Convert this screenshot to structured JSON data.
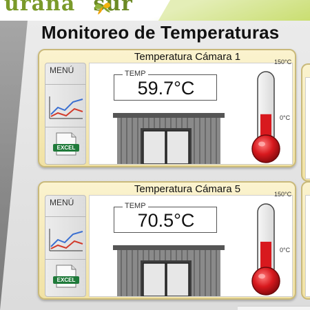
{
  "brand": {
    "part1": "urana",
    "part2": "sur"
  },
  "page": {
    "title": "Monitoreo de Temperaturas"
  },
  "panels": [
    {
      "title": "Temperatura Cámara 1",
      "menu_label": "MENÚ",
      "excel_label": "EXCEL",
      "temp_label": "TEMP",
      "temp_value": "59.7°C",
      "temp_celsius": 59.7,
      "scale_max_label": "150°C",
      "scale_min_label": "0°C",
      "scale_max": 150,
      "scale_min": 0
    },
    {
      "title": "Temperatura Cámara 5",
      "menu_label": "MENÚ",
      "excel_label": "EXCEL",
      "temp_label": "TEMP",
      "temp_value": "70.5°C",
      "temp_celsius": 70.5,
      "scale_max_label": "150°C",
      "scale_min_label": "0°C",
      "scale_max": 150,
      "scale_min": 0
    }
  ],
  "colors": {
    "accent_green": "#7a9a2a",
    "panel_bg": "#f6ebbb",
    "thermo_red": "#d8191e",
    "excel_green": "#1f7a3a"
  }
}
